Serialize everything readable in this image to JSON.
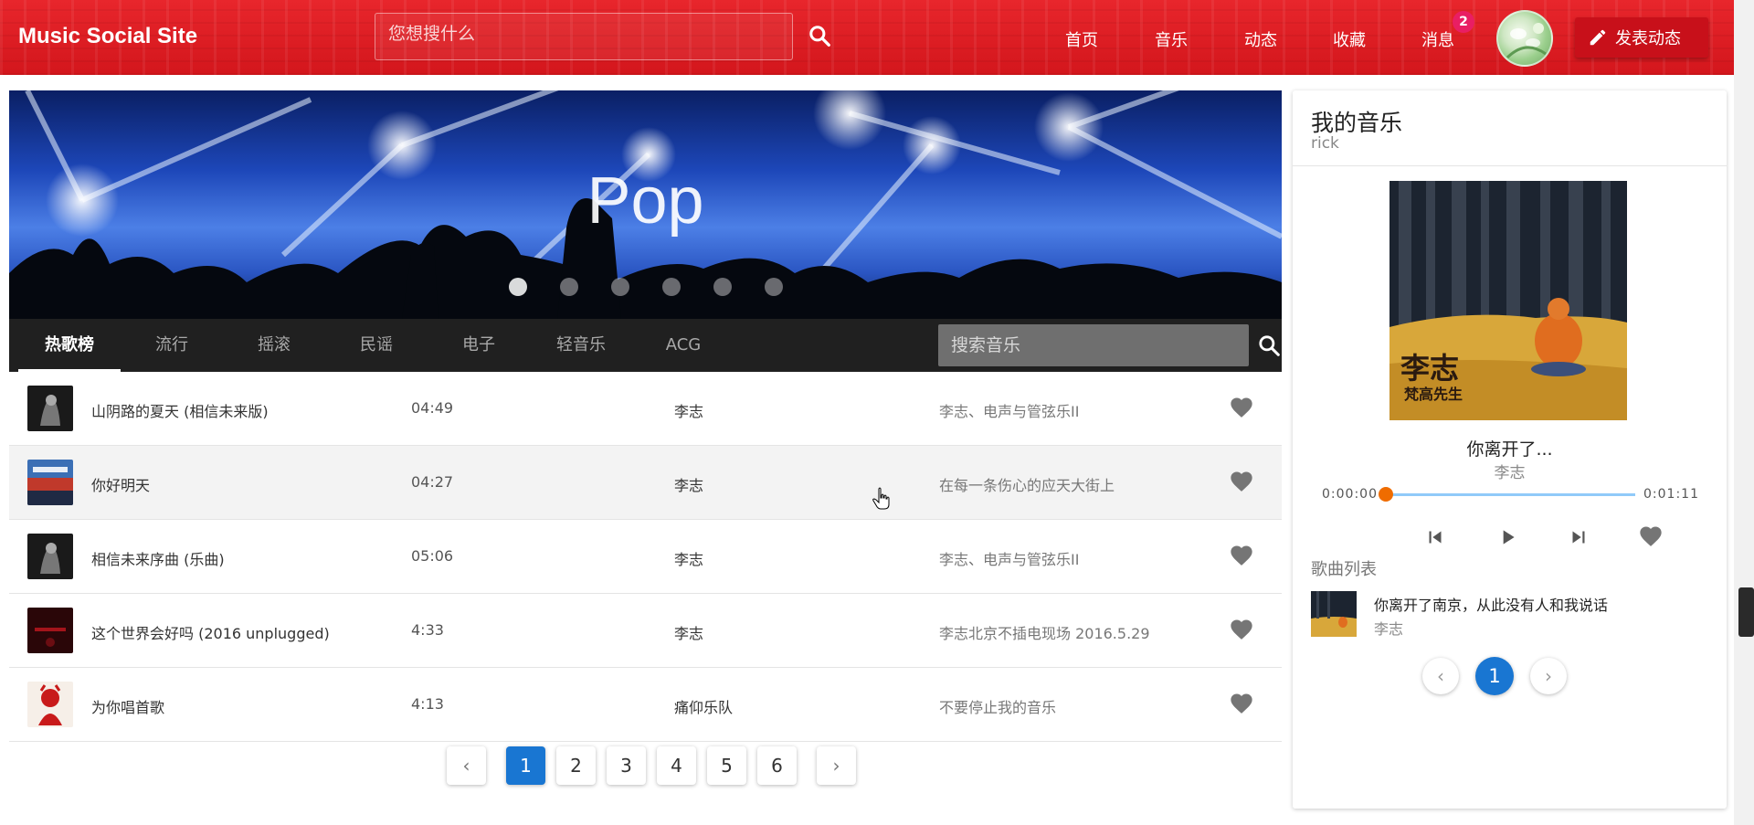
{
  "header": {
    "brand": "Music Social Site",
    "search_placeholder": "您想搜什么",
    "nav": [
      "首页",
      "音乐",
      "动态",
      "收藏",
      "消息"
    ],
    "messages_badge": "2",
    "post_button": "发表动态"
  },
  "banner": {
    "title": "Pop",
    "slide_count": 6,
    "active_slide": 1
  },
  "tabs": {
    "items": [
      "热歌榜",
      "流行",
      "摇滚",
      "民谣",
      "电子",
      "轻音乐",
      "ACG"
    ],
    "active": "热歌榜",
    "search_placeholder": "搜索音乐"
  },
  "songs": [
    {
      "name": "山阴路的夏天 (相信未来版)",
      "duration": "04:49",
      "artist": "李志",
      "album": "李志、电声与管弦乐II",
      "cover": "bw"
    },
    {
      "name": "你好明天",
      "duration": "04:27",
      "artist": "李志",
      "album": "在每一条伤心的应天大街上",
      "cover": "city"
    },
    {
      "name": "相信未来序曲 (乐曲)",
      "duration": "05:06",
      "artist": "李志",
      "album": "李志、电声与管弦乐II",
      "cover": "bw"
    },
    {
      "name": "这个世界会好吗 (2016 unplugged)",
      "duration": "4:33",
      "artist": "李志",
      "album": "李志北京不插电现场 2016.5.29",
      "cover": "dark-red"
    },
    {
      "name": "为你唱首歌",
      "duration": "4:13",
      "artist": "痛仰乐队",
      "album": "不要停止我的音乐",
      "cover": "red-art"
    }
  ],
  "pagination": {
    "pages": [
      "1",
      "2",
      "3",
      "4",
      "5",
      "6"
    ],
    "current": "1",
    "prev": "‹",
    "next": "›"
  },
  "my_music": {
    "title": "我的音乐",
    "user": "rick",
    "album_caption_1": "李志",
    "album_caption_2": "梵高先生",
    "now_playing_title": "你离开了...",
    "now_playing_artist": "李志",
    "time_current": "0:00:00",
    "time_total": "0:01:11",
    "progress": 0.0,
    "playlist_label": "歌曲列表",
    "playlist": [
      {
        "name": "你离开了南京，从此没有人和我说话",
        "artist": "李志"
      }
    ],
    "playlist_page": "1",
    "prev": "‹",
    "next": "›"
  },
  "colors": {
    "header_red": "#d3161c",
    "accent_blue": "#1976d2",
    "progress_knob": "#ef6c00",
    "heart": "#757575",
    "badge": "#e91e63"
  }
}
